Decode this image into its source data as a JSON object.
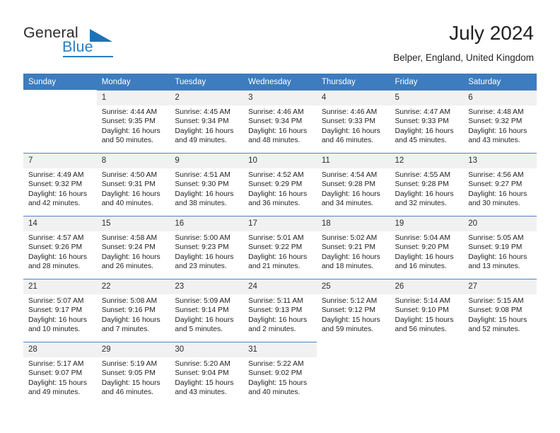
{
  "brand": {
    "word_general": "General",
    "word_blue": "Blue",
    "triangle_icon": "triangle-icon",
    "accent_color": "#2b7cc0"
  },
  "header": {
    "title": "July 2024",
    "subtitle": "Belper, England, United Kingdom",
    "header_bg_color": "#3c7cbf",
    "daynum_bg_color": "#f1f1f1"
  },
  "weekdays": [
    "Sunday",
    "Monday",
    "Tuesday",
    "Wednesday",
    "Thursday",
    "Friday",
    "Saturday"
  ],
  "labels": {
    "sunrise_prefix": "Sunrise:",
    "sunset_prefix": "Sunset:",
    "daylight_prefix": "Daylight:"
  },
  "weeks": [
    [
      {
        "day": "",
        "line1": "",
        "line2": "",
        "line3": "",
        "line4": ""
      },
      {
        "day": "1",
        "line1": "Sunrise: 4:44 AM",
        "line2": "Sunset: 9:35 PM",
        "line3": "Daylight: 16 hours",
        "line4": "and 50 minutes."
      },
      {
        "day": "2",
        "line1": "Sunrise: 4:45 AM",
        "line2": "Sunset: 9:34 PM",
        "line3": "Daylight: 16 hours",
        "line4": "and 49 minutes."
      },
      {
        "day": "3",
        "line1": "Sunrise: 4:46 AM",
        "line2": "Sunset: 9:34 PM",
        "line3": "Daylight: 16 hours",
        "line4": "and 48 minutes."
      },
      {
        "day": "4",
        "line1": "Sunrise: 4:46 AM",
        "line2": "Sunset: 9:33 PM",
        "line3": "Daylight: 16 hours",
        "line4": "and 46 minutes."
      },
      {
        "day": "5",
        "line1": "Sunrise: 4:47 AM",
        "line2": "Sunset: 9:33 PM",
        "line3": "Daylight: 16 hours",
        "line4": "and 45 minutes."
      },
      {
        "day": "6",
        "line1": "Sunrise: 4:48 AM",
        "line2": "Sunset: 9:32 PM",
        "line3": "Daylight: 16 hours",
        "line4": "and 43 minutes."
      }
    ],
    [
      {
        "day": "7",
        "line1": "Sunrise: 4:49 AM",
        "line2": "Sunset: 9:32 PM",
        "line3": "Daylight: 16 hours",
        "line4": "and 42 minutes."
      },
      {
        "day": "8",
        "line1": "Sunrise: 4:50 AM",
        "line2": "Sunset: 9:31 PM",
        "line3": "Daylight: 16 hours",
        "line4": "and 40 minutes."
      },
      {
        "day": "9",
        "line1": "Sunrise: 4:51 AM",
        "line2": "Sunset: 9:30 PM",
        "line3": "Daylight: 16 hours",
        "line4": "and 38 minutes."
      },
      {
        "day": "10",
        "line1": "Sunrise: 4:52 AM",
        "line2": "Sunset: 9:29 PM",
        "line3": "Daylight: 16 hours",
        "line4": "and 36 minutes."
      },
      {
        "day": "11",
        "line1": "Sunrise: 4:54 AM",
        "line2": "Sunset: 9:28 PM",
        "line3": "Daylight: 16 hours",
        "line4": "and 34 minutes."
      },
      {
        "day": "12",
        "line1": "Sunrise: 4:55 AM",
        "line2": "Sunset: 9:28 PM",
        "line3": "Daylight: 16 hours",
        "line4": "and 32 minutes."
      },
      {
        "day": "13",
        "line1": "Sunrise: 4:56 AM",
        "line2": "Sunset: 9:27 PM",
        "line3": "Daylight: 16 hours",
        "line4": "and 30 minutes."
      }
    ],
    [
      {
        "day": "14",
        "line1": "Sunrise: 4:57 AM",
        "line2": "Sunset: 9:26 PM",
        "line3": "Daylight: 16 hours",
        "line4": "and 28 minutes."
      },
      {
        "day": "15",
        "line1": "Sunrise: 4:58 AM",
        "line2": "Sunset: 9:24 PM",
        "line3": "Daylight: 16 hours",
        "line4": "and 26 minutes."
      },
      {
        "day": "16",
        "line1": "Sunrise: 5:00 AM",
        "line2": "Sunset: 9:23 PM",
        "line3": "Daylight: 16 hours",
        "line4": "and 23 minutes."
      },
      {
        "day": "17",
        "line1": "Sunrise: 5:01 AM",
        "line2": "Sunset: 9:22 PM",
        "line3": "Daylight: 16 hours",
        "line4": "and 21 minutes."
      },
      {
        "day": "18",
        "line1": "Sunrise: 5:02 AM",
        "line2": "Sunset: 9:21 PM",
        "line3": "Daylight: 16 hours",
        "line4": "and 18 minutes."
      },
      {
        "day": "19",
        "line1": "Sunrise: 5:04 AM",
        "line2": "Sunset: 9:20 PM",
        "line3": "Daylight: 16 hours",
        "line4": "and 16 minutes."
      },
      {
        "day": "20",
        "line1": "Sunrise: 5:05 AM",
        "line2": "Sunset: 9:19 PM",
        "line3": "Daylight: 16 hours",
        "line4": "and 13 minutes."
      }
    ],
    [
      {
        "day": "21",
        "line1": "Sunrise: 5:07 AM",
        "line2": "Sunset: 9:17 PM",
        "line3": "Daylight: 16 hours",
        "line4": "and 10 minutes."
      },
      {
        "day": "22",
        "line1": "Sunrise: 5:08 AM",
        "line2": "Sunset: 9:16 PM",
        "line3": "Daylight: 16 hours",
        "line4": "and 7 minutes."
      },
      {
        "day": "23",
        "line1": "Sunrise: 5:09 AM",
        "line2": "Sunset: 9:14 PM",
        "line3": "Daylight: 16 hours",
        "line4": "and 5 minutes."
      },
      {
        "day": "24",
        "line1": "Sunrise: 5:11 AM",
        "line2": "Sunset: 9:13 PM",
        "line3": "Daylight: 16 hours",
        "line4": "and 2 minutes."
      },
      {
        "day": "25",
        "line1": "Sunrise: 5:12 AM",
        "line2": "Sunset: 9:12 PM",
        "line3": "Daylight: 15 hours",
        "line4": "and 59 minutes."
      },
      {
        "day": "26",
        "line1": "Sunrise: 5:14 AM",
        "line2": "Sunset: 9:10 PM",
        "line3": "Daylight: 15 hours",
        "line4": "and 56 minutes."
      },
      {
        "day": "27",
        "line1": "Sunrise: 5:15 AM",
        "line2": "Sunset: 9:08 PM",
        "line3": "Daylight: 15 hours",
        "line4": "and 52 minutes."
      }
    ],
    [
      {
        "day": "28",
        "line1": "Sunrise: 5:17 AM",
        "line2": "Sunset: 9:07 PM",
        "line3": "Daylight: 15 hours",
        "line4": "and 49 minutes."
      },
      {
        "day": "29",
        "line1": "Sunrise: 5:19 AM",
        "line2": "Sunset: 9:05 PM",
        "line3": "Daylight: 15 hours",
        "line4": "and 46 minutes."
      },
      {
        "day": "30",
        "line1": "Sunrise: 5:20 AM",
        "line2": "Sunset: 9:04 PM",
        "line3": "Daylight: 15 hours",
        "line4": "and 43 minutes."
      },
      {
        "day": "31",
        "line1": "Sunrise: 5:22 AM",
        "line2": "Sunset: 9:02 PM",
        "line3": "Daylight: 15 hours",
        "line4": "and 40 minutes."
      },
      {
        "day": "",
        "line1": "",
        "line2": "",
        "line3": "",
        "line4": ""
      },
      {
        "day": "",
        "line1": "",
        "line2": "",
        "line3": "",
        "line4": ""
      },
      {
        "day": "",
        "line1": "",
        "line2": "",
        "line3": "",
        "line4": ""
      }
    ]
  ]
}
